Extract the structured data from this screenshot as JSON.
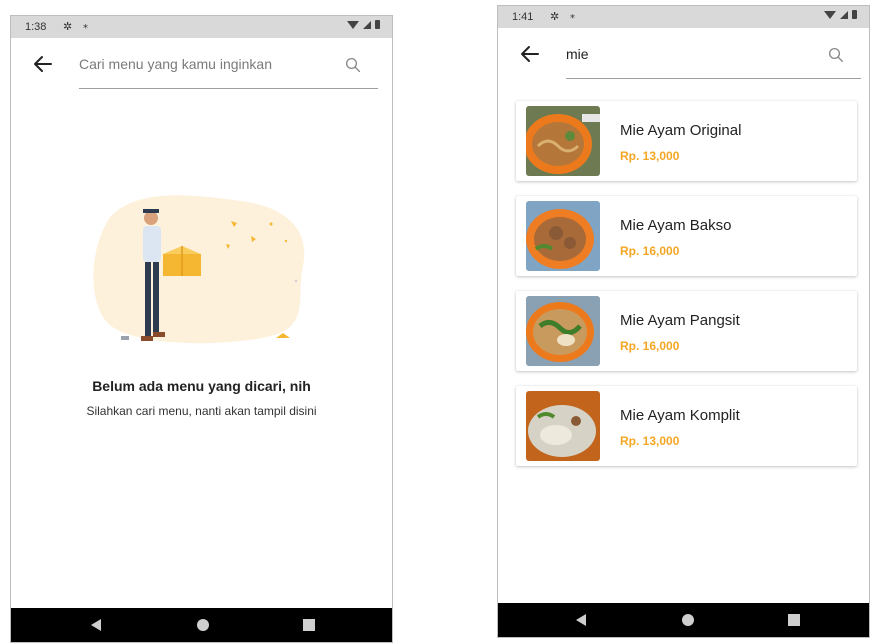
{
  "accent_color": "#f5a623",
  "left_screen": {
    "status_time": "1:38",
    "search": {
      "placeholder": "Cari menu yang kamu inginkan",
      "value": ""
    },
    "empty_state": {
      "title": "Belum ada menu yang dicari, nih",
      "subtitle": "Silahkan cari menu, nanti akan tampil disini"
    }
  },
  "right_screen": {
    "status_time": "1:41",
    "search": {
      "placeholder": "",
      "value": "mie"
    },
    "results": [
      {
        "name": "Mie Ayam Original",
        "price": "Rp. 13,000"
      },
      {
        "name": "Mie Ayam Bakso",
        "price": "Rp. 16,000"
      },
      {
        "name": "Mie Ayam Pangsit",
        "price": "Rp. 16,000"
      },
      {
        "name": "Mie Ayam Komplit",
        "price": "Rp. 13,000"
      }
    ]
  },
  "icons": {
    "back": "arrow-left-icon",
    "search": "search-icon",
    "settings": "gear-icon",
    "wifi": "wifi-icon",
    "signal": "signal-icon",
    "battery": "battery-icon",
    "nav_back": "triangle-back-icon",
    "nav_home": "circle-home-icon",
    "nav_recent": "square-recent-icon"
  }
}
